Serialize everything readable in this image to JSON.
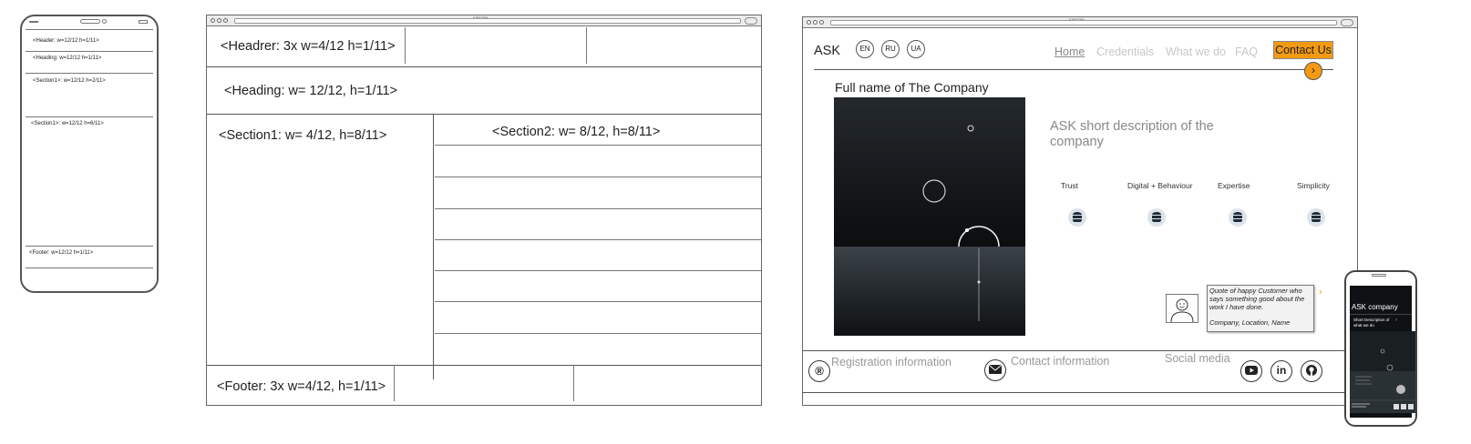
{
  "phone_wire": {
    "header": "<Header: w=12/12 h=1/11>",
    "heading": "<Heading: w=12/12 h=1/11>",
    "section1": "<Section1>: w=12/12 h=2/11>",
    "section2": "<Section1>: w=12/12 h=6/11>",
    "footer": "<Footer: w=12/12 h=1/11>"
  },
  "browser_wire": {
    "tab_title": "A Web Page",
    "header": "<Headrer: 3x w=4/12 h=1/11>",
    "heading": "<Heading: w= 12/12, h=1/11>",
    "section1": "<Section1: w= 4/12, h=8/11>",
    "section2": "<Section2: w= 8/12, h=8/11>",
    "footer": "<Footer: 3x w=4/12, h=1/11>"
  },
  "site_mock": {
    "tab_title": "A Web Page",
    "logo": "ASK",
    "languages": [
      "EN",
      "RU",
      "UA"
    ],
    "nav": [
      "Home",
      "Credentials",
      "What we do",
      "FAQ"
    ],
    "contact_button": "Contact Us",
    "next_arrow": "›",
    "company_name": "Full name of The Company",
    "short_description": "ASK short description of the company",
    "values": [
      {
        "label": "Trust",
        "icon": "database-icon"
      },
      {
        "label": "Digital + Behaviour",
        "icon": "database-icon"
      },
      {
        "label": "Expertise",
        "icon": "database-icon"
      },
      {
        "label": "Simplicity",
        "icon": "database-icon"
      }
    ],
    "quote": "Quote of happy Customer who says something good about the work I have done.",
    "quote_author": "Company, Location, Name",
    "quote_next": "›",
    "footer": {
      "registration": "Registration information",
      "registration_icon": "®",
      "contact": "Contact information",
      "social": "Social media"
    }
  },
  "mobile_mock": {
    "title": "ASK company",
    "description": "Short Description of what we do",
    "arrow": "›"
  }
}
